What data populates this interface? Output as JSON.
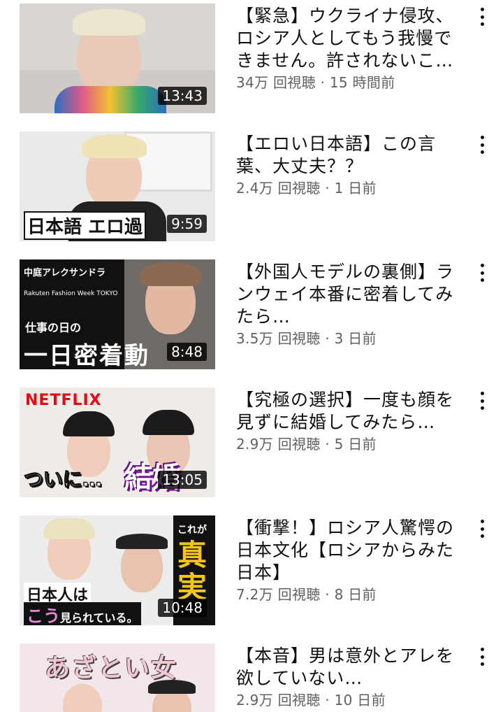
{
  "videos": [
    {
      "title_lines": [
        "【緊急】ウクライナ侵攻、",
        "ロシア人としてもう我慢で",
        "きません。許されないこ…"
      ],
      "views": "34万 回視聴",
      "age": "15 時間前",
      "duration": "13:43"
    },
    {
      "title_lines": [
        "【エロい日本語】この言",
        "葉、大丈夫？？"
      ],
      "views": "2.4万 回視聴",
      "age": "1 日前",
      "duration": "9:59",
      "thumb_text": "日本語 エロ過"
    },
    {
      "title_lines": [
        "【外国人モデルの裏側】ラ",
        "ンウェイ本番に密着してみ",
        "たら…"
      ],
      "views": "3.5万 回視聴",
      "age": "3 日前",
      "duration": "8:48",
      "thumb_text": [
        "中庭アレクサンドラ",
        "Rakuten Fashion Week TOKYO",
        "仕事の日の",
        "一日密着動"
      ]
    },
    {
      "title_lines": [
        "【究極の選択】一度も顔を",
        "見ずに結婚してみたら…"
      ],
      "views": "2.9万 回視聴",
      "age": "5 日前",
      "duration": "13:05",
      "thumb_text": [
        "NETFLIX",
        "ついに…",
        "結婚"
      ]
    },
    {
      "title_lines": [
        "【衝撃！】ロシア人驚愕の",
        "日本文化【ロシアからみた",
        "日本】"
      ],
      "views": "7.2万 回視聴",
      "age": "8 日前",
      "duration": "10:48",
      "thumb_text": [
        "これが",
        "真実",
        "日本人は",
        "こう",
        "見られている。"
      ]
    },
    {
      "title_lines": [
        "【本音】男は意外とアレを",
        "欲していない…"
      ],
      "views": "2.9万 回視聴",
      "age": "10 日前",
      "duration": "",
      "thumb_text": [
        "あざとい女"
      ]
    }
  ],
  "separator": " · ",
  "icons": {
    "more": "more-vert-icon"
  },
  "colors": {
    "title": "#0f0f0f",
    "meta": "#606060",
    "netflix": "#e50914",
    "magenta": "#c2185b"
  }
}
